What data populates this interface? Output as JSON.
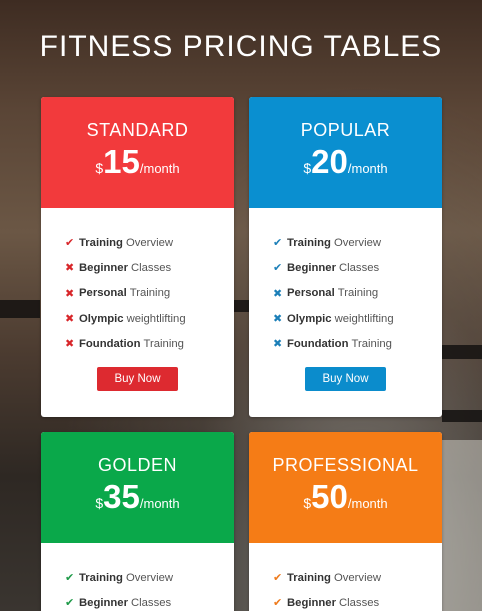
{
  "title": "FITNESS PRICING TABLES",
  "colors": {
    "standard": "#f23a3c",
    "popular": "#0a8fd0",
    "golden": "#0aa84a",
    "professional": "#f57c16",
    "check_standard": "#d8262a",
    "check_popular": "#1b7fb8",
    "check_golden": "#1e9a48",
    "check_professional": "#ee7a1c"
  },
  "plans": [
    {
      "name": "STANDARD",
      "currency": "$",
      "price": "15",
      "period": "/month",
      "button": "Buy Now",
      "features": [
        {
          "icon": "check-icon",
          "mark": "✔",
          "bold": "Training",
          "rest": "Overview"
        },
        {
          "icon": "cross-icon",
          "mark": "✖",
          "bold": "Beginner",
          "rest": "Classes"
        },
        {
          "icon": "cross-icon",
          "mark": "✖",
          "bold": "Personal",
          "rest": "Training"
        },
        {
          "icon": "cross-icon",
          "mark": "✖",
          "bold": "Olympic",
          "rest": "weightlifting"
        },
        {
          "icon": "cross-icon",
          "mark": "✖",
          "bold": "Foundation",
          "rest": "Training"
        }
      ]
    },
    {
      "name": "POPULAR",
      "currency": "$",
      "price": "20",
      "period": "/month",
      "button": "Buy Now",
      "features": [
        {
          "icon": "check-icon",
          "mark": "✔",
          "bold": "Training",
          "rest": "Overview"
        },
        {
          "icon": "check-icon",
          "mark": "✔",
          "bold": "Beginner",
          "rest": "Classes"
        },
        {
          "icon": "cross-icon",
          "mark": "✖",
          "bold": "Personal",
          "rest": "Training"
        },
        {
          "icon": "cross-icon",
          "mark": "✖",
          "bold": "Olympic",
          "rest": "weightlifting"
        },
        {
          "icon": "cross-icon",
          "mark": "✖",
          "bold": "Foundation",
          "rest": "Training"
        }
      ]
    },
    {
      "name": "GOLDEN",
      "currency": "$",
      "price": "35",
      "period": "/month",
      "features": [
        {
          "icon": "check-icon",
          "mark": "✔",
          "bold": "Training",
          "rest": "Overview"
        },
        {
          "icon": "check-icon",
          "mark": "✔",
          "bold": "Beginner",
          "rest": "Classes"
        }
      ]
    },
    {
      "name": "PROFESSIONAL",
      "currency": "$",
      "price": "50",
      "period": "/month",
      "features": [
        {
          "icon": "check-icon",
          "mark": "✔",
          "bold": "Training",
          "rest": "Overview"
        },
        {
          "icon": "check-icon",
          "mark": "✔",
          "bold": "Beginner",
          "rest": "Classes"
        }
      ]
    }
  ]
}
